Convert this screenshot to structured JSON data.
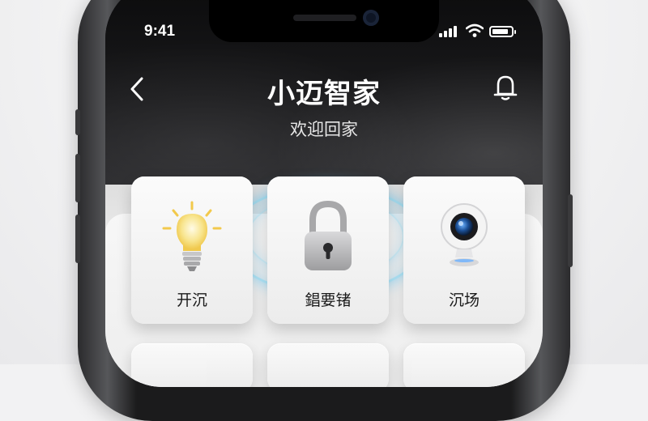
{
  "status_bar": {
    "time": "9:41",
    "signal_icon": "signal-bars-icon",
    "wifi_icon": "wifi-icon",
    "battery_icon": "battery-icon",
    "battery_level": 0.85
  },
  "header": {
    "title": "小迈智家",
    "subtitle": "欢迎回家",
    "back_icon": "chevron-left-icon",
    "bell_icon": "bell-icon"
  },
  "devices": [
    {
      "label": "开沉",
      "icon": "light-bulb-icon",
      "accent": "#f5d061"
    },
    {
      "label": "錩要锗",
      "icon": "padlock-icon",
      "accent": "#b9b9bb"
    },
    {
      "label": "沉场",
      "icon": "security-camera-icon",
      "accent": "#2f7fd0"
    }
  ],
  "colors": {
    "screen_dark": "#101012",
    "panel_light": "#f2f2f2",
    "glow": "#78dcff"
  }
}
